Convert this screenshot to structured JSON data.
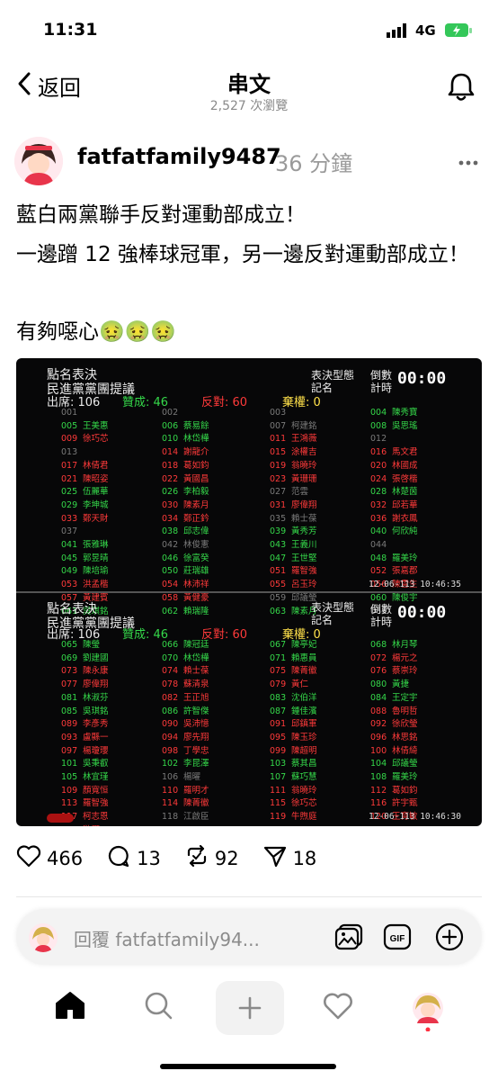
{
  "status_bar": {
    "time": "11:31",
    "network": "4G"
  },
  "header": {
    "back_label": "返回",
    "title": "串文",
    "views": "2,527 次瀏覽"
  },
  "post": {
    "username": "fatfatfamily9487",
    "time_ago": "36 分鐘",
    "lines": [
      "藍白兩黨聯手反對運動部成立！",
      "一邊蹭 12 強棒球冠軍，另一邊反對運動部成立！",
      "有夠噁心🤢🤢🤢"
    ]
  },
  "vote_board": {
    "panels": [
      {
        "title1": "點名表決",
        "title2": "民進黨黨團提議",
        "mode_label": "表決型態",
        "mode_value": "記名",
        "timer_label1": "倒數",
        "timer_label2": "計時",
        "timer": "00:00",
        "attend": "出席: 106",
        "yes": "贊成: 46",
        "no": "反對: 60",
        "abstain": "棄權: 0",
        "timestamp": "12-06-113 10:46:35",
        "columns": [
          [
            [
              "001",
              "",
              "gr"
            ],
            [
              "005",
              "王美惠",
              "g"
            ],
            [
              "009",
              "徐巧芯",
              "r"
            ],
            [
              "013",
              "",
              "gr"
            ],
            [
              "017",
              "林倩君",
              "r"
            ],
            [
              "021",
              "陳昭姿",
              "r"
            ],
            [
              "025",
              "伍麗華",
              "g"
            ],
            [
              "029",
              "李坤城",
              "g"
            ],
            [
              "033",
              "鄭天財",
              "r"
            ],
            [
              "037",
              "",
              "gr"
            ],
            [
              "041",
              "張雅琳",
              "g"
            ],
            [
              "045",
              "郭昱晴",
              "g"
            ],
            [
              "049",
              "陳培瑜",
              "g"
            ],
            [
              "053",
              "洪孟楷",
              "r"
            ],
            [
              "057",
              "黃建賓",
              "r"
            ],
            [
              "061",
              "吳琪銘",
              "g"
            ]
          ],
          [
            [
              "002",
              "",
              "gr"
            ],
            [
              "006",
              "蔡易餘",
              "g"
            ],
            [
              "010",
              "林岱樺",
              "g"
            ],
            [
              "014",
              "謝龍介",
              "r"
            ],
            [
              "018",
              "葛如鈞",
              "r"
            ],
            [
              "022",
              "黃國昌",
              "r"
            ],
            [
              "026",
              "李柏毅",
              "g"
            ],
            [
              "030",
              "陳素月",
              "r"
            ],
            [
              "034",
              "鄭正鈐",
              "r"
            ],
            [
              "038",
              "邱志偉",
              "g"
            ],
            [
              "042",
              "林俊憲",
              "gr"
            ],
            [
              "046",
              "徐富癸",
              "g"
            ],
            [
              "050",
              "莊瑞雄",
              "g"
            ],
            [
              "054",
              "林沛祥",
              "r"
            ],
            [
              "058",
              "黃健豪",
              "r"
            ],
            [
              "062",
              "賴瑞隆",
              "g"
            ]
          ],
          [
            [
              "003",
              "",
              "gr"
            ],
            [
              "007",
              "柯建銘",
              "gr"
            ],
            [
              "011",
              "王鴻薇",
              "r"
            ],
            [
              "015",
              "涂權吉",
              "r"
            ],
            [
              "019",
              "翁曉玲",
              "r"
            ],
            [
              "023",
              "黃珊珊",
              "r"
            ],
            [
              "027",
              "范雲",
              "gr"
            ],
            [
              "031",
              "廖偉翔",
              "r"
            ],
            [
              "035",
              "賴士葆",
              "gr"
            ],
            [
              "039",
              "黃秀芳",
              "g"
            ],
            [
              "043",
              "王義川",
              "g"
            ],
            [
              "047",
              "王世堅",
              "g"
            ],
            [
              "051",
              "羅智強",
              "r"
            ],
            [
              "055",
              "呂玉玲",
              "r"
            ],
            [
              "059",
              "邱議瑩",
              "gr"
            ],
            [
              "063",
              "陳素月",
              "g"
            ]
          ],
          [
            [
              "004",
              "陳秀寶",
              "g"
            ],
            [
              "008",
              "吳思瑤",
              "g"
            ],
            [
              "012",
              "",
              "gr"
            ],
            [
              "016",
              "馬文君",
              "r"
            ],
            [
              "020",
              "林國成",
              "r"
            ],
            [
              "024",
              "張啓楷",
              "r"
            ],
            [
              "028",
              "林楚茵",
              "g"
            ],
            [
              "032",
              "邱若華",
              "r"
            ],
            [
              "036",
              "謝衣鳳",
              "r"
            ],
            [
              "040",
              "何欣純",
              "g"
            ],
            [
              "044",
              "",
              "gr"
            ],
            [
              "048",
              "羅美玲",
              "g"
            ],
            [
              "052",
              "張嘉郡",
              "r"
            ],
            [
              "056",
              "陳雪生",
              "r"
            ],
            [
              "060",
              "陳俊宇",
              "g"
            ],
            [
              "064",
              "",
              "gr"
            ]
          ]
        ]
      },
      {
        "title1": "點名表決",
        "title2": "民進黨黨團提議",
        "mode_label": "表決型態",
        "mode_value": "記名",
        "timer_label1": "倒數",
        "timer_label2": "計時",
        "timer": "00:00",
        "attend": "出席: 106",
        "yes": "贊成: 46",
        "no": "反對: 60",
        "abstain": "棄權: 0",
        "timestamp": "12-06-113 10:46:30",
        "columns": [
          [
            [
              "065",
              "陳瑩",
              "g"
            ],
            [
              "069",
              "劉建國",
              "g"
            ],
            [
              "073",
              "陳永康",
              "r"
            ],
            [
              "077",
              "廖偉翔",
              "r"
            ],
            [
              "081",
              "林淑芬",
              "g"
            ],
            [
              "085",
              "吳琪銘",
              "g"
            ],
            [
              "089",
              "李彥秀",
              "r"
            ],
            [
              "093",
              "盧縣一",
              "r"
            ],
            [
              "097",
              "楊瓊瓔",
              "r"
            ],
            [
              "101",
              "吳秉叡",
              "g"
            ],
            [
              "105",
              "林宜瑾",
              "g"
            ],
            [
              "109",
              "顏寬恒",
              "r"
            ],
            [
              "113",
              "羅智強",
              "r"
            ],
            [
              "117",
              "柯志恩",
              "r"
            ],
            [
              "121",
              "游灝",
              "r"
            ]
          ],
          [
            [
              "066",
              "陳冠廷",
              "g"
            ],
            [
              "070",
              "林岱樺",
              "g"
            ],
            [
              "074",
              "賴士葆",
              "r"
            ],
            [
              "078",
              "蘇清泉",
              "r"
            ],
            [
              "082",
              "王正旭",
              "r"
            ],
            [
              "086",
              "許智傑",
              "g"
            ],
            [
              "090",
              "吳沛憶",
              "r"
            ],
            [
              "094",
              "廖先翔",
              "r"
            ],
            [
              "098",
              "丁學忠",
              "r"
            ],
            [
              "102",
              "李昆澤",
              "g"
            ],
            [
              "106",
              "楊曜",
              "gr"
            ],
            [
              "110",
              "羅明才",
              "r"
            ],
            [
              "114",
              "陳菁徽",
              "r"
            ],
            [
              "118",
              "江啟臣",
              "gr"
            ]
          ],
          [
            [
              "067",
              "陳亭妃",
              "g"
            ],
            [
              "071",
              "賴惠員",
              "g"
            ],
            [
              "075",
              "陳菁徽",
              "r"
            ],
            [
              "079",
              "黃仁",
              "r"
            ],
            [
              "083",
              "沈伯洋",
              "g"
            ],
            [
              "087",
              "鍾佳濱",
              "g"
            ],
            [
              "091",
              "邱鎮軍",
              "r"
            ],
            [
              "095",
              "陳玉珍",
              "r"
            ],
            [
              "099",
              "陳超明",
              "r"
            ],
            [
              "103",
              "蔡其昌",
              "g"
            ],
            [
              "107",
              "蘇巧慧",
              "g"
            ],
            [
              "111",
              "翁曉玲",
              "r"
            ],
            [
              "115",
              "徐巧芯",
              "r"
            ],
            [
              "119",
              "牛煦庭",
              "r"
            ]
          ],
          [
            [
              "068",
              "林月琴",
              "g"
            ],
            [
              "072",
              "楊元之",
              "r"
            ],
            [
              "076",
              "蔡崇玲",
              "r"
            ],
            [
              "080",
              "黃捷",
              "g"
            ],
            [
              "084",
              "王定宇",
              "g"
            ],
            [
              "088",
              "魯明哲",
              "r"
            ],
            [
              "092",
              "徐欣瑩",
              "r"
            ],
            [
              "096",
              "林思銘",
              "r"
            ],
            [
              "100",
              "林倩綺",
              "r"
            ],
            [
              "104",
              "邱議瑩",
              "g"
            ],
            [
              "108",
              "羅美玲",
              "g"
            ],
            [
              "112",
              "葛如鈞",
              "r"
            ],
            [
              "116",
              "許宇甄",
              "r"
            ],
            [
              "120",
              "王育敏",
              "r"
            ]
          ]
        ]
      }
    ]
  },
  "actions": {
    "likes": "466",
    "comments": "13",
    "reposts": "92",
    "shares": "18"
  },
  "reply_bar": {
    "placeholder": "回覆 fatfatfamily94..."
  },
  "colors": {
    "accent": "#000000",
    "board_green": "#35d84a",
    "board_red": "#ff3a3a",
    "board_yellow": "#ffe14a",
    "notify_dot": "#ff3040"
  },
  "icons": [
    "back-chevron-icon",
    "bell-icon",
    "more-icon",
    "heart-icon",
    "comment-icon",
    "repost-icon",
    "share-icon",
    "image-icon",
    "gif-icon",
    "plus-icon",
    "home-icon",
    "search-icon",
    "create-icon",
    "activity-icon",
    "profile-avatar"
  ]
}
